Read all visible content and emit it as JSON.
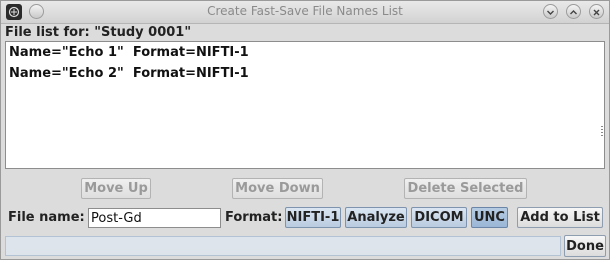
{
  "window": {
    "title": "Create Fast-Save File Names List",
    "controls": [
      "chevron-down-icon",
      "chevron-up-icon",
      "close-icon"
    ]
  },
  "list": {
    "header": "File list for: \"Study 0001\"",
    "items": [
      "Name=\"Echo 1\"  Format=NIFTI-1",
      "Name=\"Echo 2\"  Format=NIFTI-1"
    ]
  },
  "actions": {
    "move_up": "Move Up",
    "move_down": "Move Down",
    "delete_selected": "Delete Selected"
  },
  "form": {
    "file_name_label": "File name:",
    "file_name_value": "Post-Gd",
    "format_label": "Format:",
    "formats": [
      "NIFTI-1",
      "Analyze",
      "DICOM",
      "UNC"
    ],
    "selected_format": "UNC",
    "add_button": "Add to List"
  },
  "footer": {
    "status": "",
    "done_button": "Done"
  }
}
